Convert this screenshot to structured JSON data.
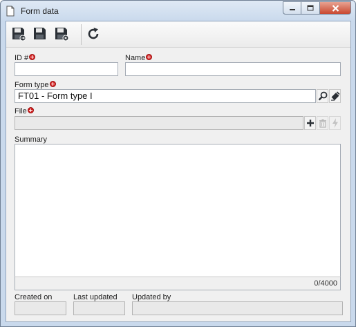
{
  "window": {
    "title": "Form data",
    "icons": {
      "title": "document-icon",
      "minimize": "minimize-icon",
      "maximize": "maximize-icon",
      "close": "close-icon"
    }
  },
  "toolbar": {
    "buttons": [
      {
        "name": "save-and-new-button",
        "icon": "save-new-icon"
      },
      {
        "name": "save-button",
        "icon": "save-icon"
      },
      {
        "name": "save-and-close-button",
        "icon": "save-close-icon"
      },
      {
        "name": "refresh-button",
        "icon": "refresh-icon"
      }
    ]
  },
  "form": {
    "id_label": "ID #",
    "id_value": "",
    "name_label": "Name",
    "name_value": "",
    "form_type_label": "Form type",
    "form_type_value": "FT01 - Form type I",
    "file_label": "File",
    "file_value": "",
    "summary_label": "Summary",
    "summary_value": "",
    "summary_counter": "0/4000",
    "created_on_label": "Created on",
    "created_on_value": "",
    "last_updated_label": "Last updated",
    "last_updated_value": "",
    "updated_by_label": "Updated by",
    "updated_by_value": ""
  },
  "colors": {
    "required_marker": "#d42020",
    "window_frame": "#c9d9ec",
    "close_button": "#c9482f"
  }
}
